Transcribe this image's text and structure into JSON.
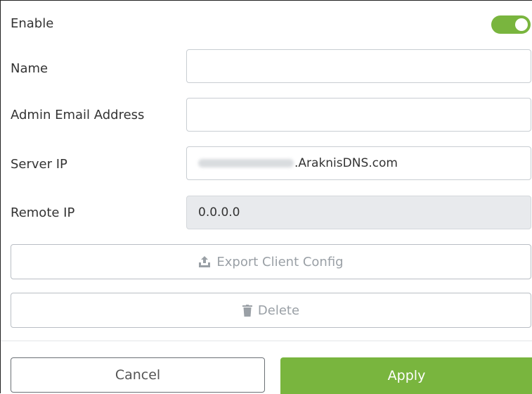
{
  "form": {
    "enable": {
      "label": "Enable",
      "value": true
    },
    "name": {
      "label": "Name",
      "value": "",
      "placeholder": ""
    },
    "admin_email": {
      "label": "Admin Email Address",
      "value": "",
      "placeholder": ""
    },
    "server_ip": {
      "label": "Server IP",
      "suffix": ".AraknisDNS.com"
    },
    "remote_ip": {
      "label": "Remote IP",
      "value": "0.0.0.0"
    }
  },
  "actions": {
    "export_label": "Export Client Config",
    "export_icon": "upload-icon",
    "delete_label": "Delete",
    "delete_icon": "trash-icon",
    "cancel_label": "Cancel",
    "apply_label": "Apply"
  },
  "colors": {
    "accent": "#79b53e",
    "disabled_text": "#9aa0a6",
    "disabled_field": "#e8eaed"
  }
}
